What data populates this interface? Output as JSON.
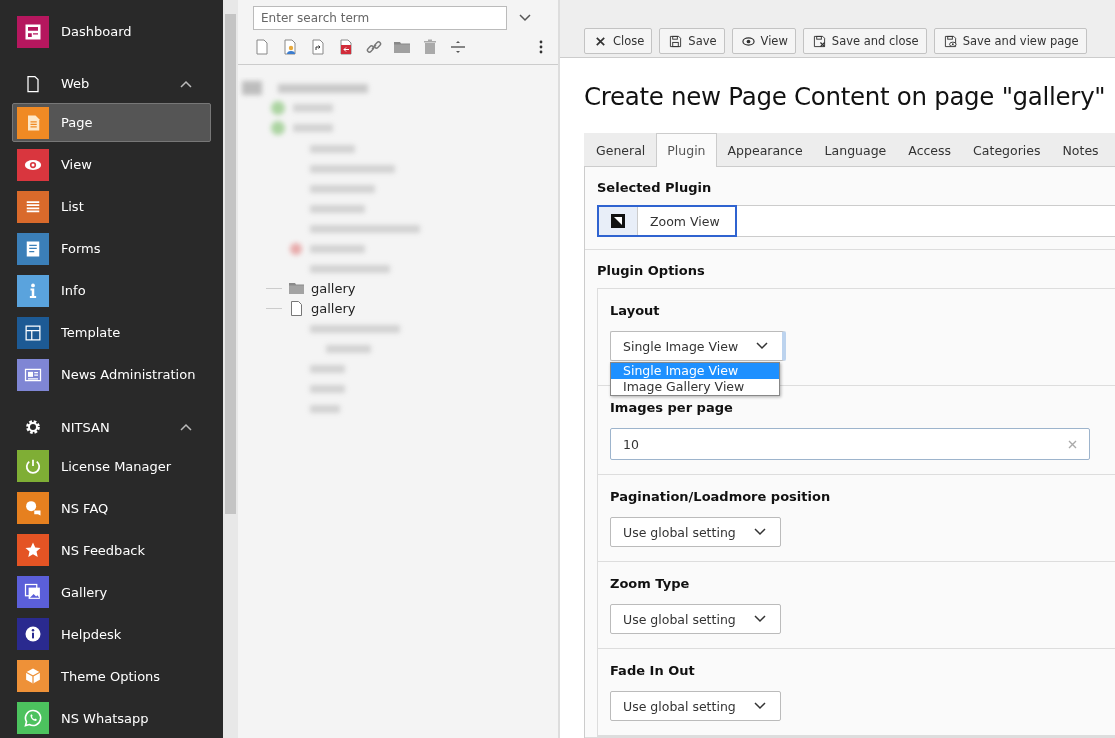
{
  "sidebar": {
    "top": [
      {
        "label": "Dashboard",
        "kind": "dashboard",
        "color": "#b5175e",
        "selected": false
      }
    ],
    "groups": [
      {
        "label": "Web",
        "kind": "page-outline",
        "expanded": true,
        "items": [
          {
            "label": "Page",
            "kind": "page",
            "color": "#f08a24",
            "selected": true
          },
          {
            "label": "View",
            "kind": "eye",
            "color": "#d9363e",
            "selected": false
          },
          {
            "label": "List",
            "kind": "list",
            "color": "#d96a2b",
            "selected": false
          },
          {
            "label": "Forms",
            "kind": "form",
            "color": "#3b7fb8",
            "selected": false
          },
          {
            "label": "Info",
            "kind": "info",
            "color": "#5aa3dd",
            "selected": false
          },
          {
            "label": "Template",
            "kind": "template",
            "color": "#1d5a94",
            "selected": false
          },
          {
            "label": "News Administration",
            "kind": "news",
            "color": "#7f86d4",
            "selected": false
          }
        ]
      },
      {
        "label": "NITSAN",
        "kind": "gear",
        "expanded": true,
        "items": [
          {
            "label": "License Manager",
            "kind": "power",
            "color": "#7fae35",
            "selected": false
          },
          {
            "label": "NS FAQ",
            "kind": "faq",
            "color": "#e6801f",
            "selected": false
          },
          {
            "label": "NS Feedback",
            "kind": "star",
            "color": "#e45424",
            "selected": false
          },
          {
            "label": "Gallery",
            "kind": "gallery",
            "color": "#5b5fd9",
            "selected": false
          },
          {
            "label": "Helpdesk",
            "kind": "helpdesk",
            "color": "#2a2a8f",
            "selected": false
          },
          {
            "label": "Theme Options",
            "kind": "box",
            "color": "#ee9138",
            "selected": false
          },
          {
            "label": "NS Whatsapp",
            "kind": "whatsapp",
            "color": "#4cc25e",
            "selected": false
          }
        ]
      }
    ]
  },
  "page_tree": {
    "search": {
      "placeholder": "Enter search term"
    },
    "nodes": [
      {
        "label": "gallery",
        "kind": "folder"
      },
      {
        "label": "gallery",
        "kind": "page"
      }
    ]
  },
  "toolbar": {
    "buttons": [
      {
        "label": "Close",
        "kind": "close"
      },
      {
        "label": "Save",
        "kind": "save"
      },
      {
        "label": "View",
        "kind": "eye"
      },
      {
        "label": "Save and close",
        "kind": "save-close"
      },
      {
        "label": "Save and view page",
        "kind": "save-view"
      }
    ]
  },
  "title": "Create new Page Content on page \"gallery\"",
  "tabs": [
    {
      "label": "General",
      "selected": false
    },
    {
      "label": "Plugin",
      "selected": true
    },
    {
      "label": "Appearance",
      "selected": false
    },
    {
      "label": "Language",
      "selected": false
    },
    {
      "label": "Access",
      "selected": false
    },
    {
      "label": "Categories",
      "selected": false
    },
    {
      "label": "Notes",
      "selected": false
    }
  ],
  "selected_plugin": {
    "label": "Selected Plugin",
    "value": "Zoom View"
  },
  "plugin_options": {
    "label": "Plugin Options",
    "fields": [
      {
        "kind": "select",
        "label": "Layout",
        "value": "Single Image View",
        "expanded": true,
        "options": [
          {
            "label": "Single Image View",
            "selected": true
          },
          {
            "label": "Image Gallery View",
            "selected": false
          }
        ]
      },
      {
        "kind": "text",
        "label": "Images per page",
        "value": "10"
      },
      {
        "kind": "select",
        "label": "Pagination/Loadmore position",
        "value": "Use global setting",
        "expanded": false
      },
      {
        "kind": "select",
        "label": "Zoom Type",
        "value": "Use global setting",
        "expanded": false
      },
      {
        "kind": "select",
        "label": "Fade In Out",
        "value": "Use global setting",
        "expanded": false
      }
    ]
  }
}
